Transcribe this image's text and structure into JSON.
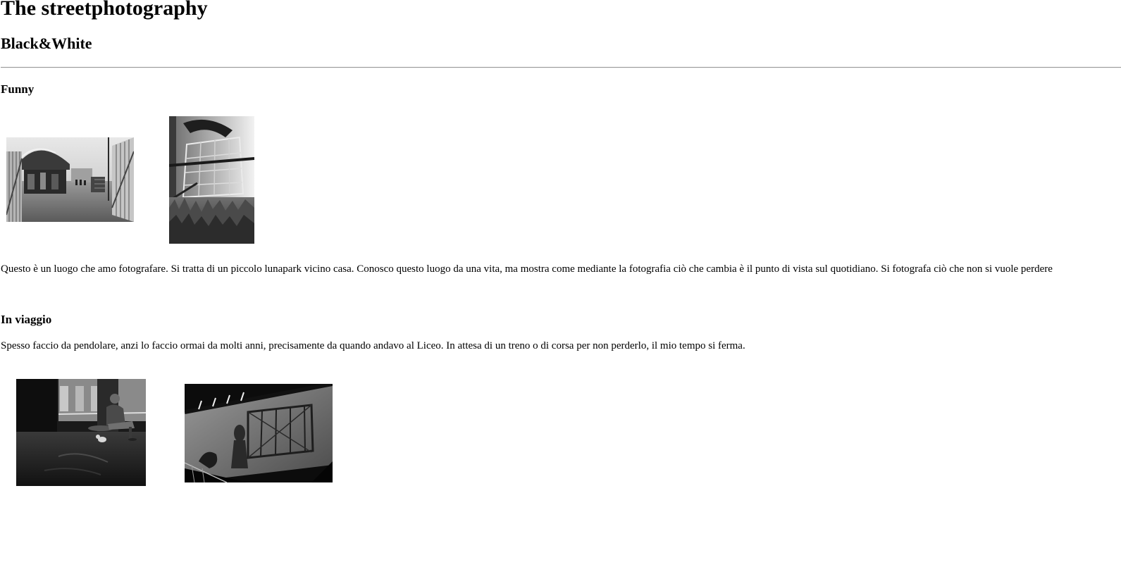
{
  "header": {
    "title": "The streetphotography",
    "subtitle": "Black&White"
  },
  "sections": {
    "funny": {
      "heading": "Funny",
      "text": "Questo è un luogo che amo fotografare. Si tratta di un piccolo lunapark vicino casa. Conosco questo luogo da una vita, ma mostra come mediante la fotografia ciò che cambia è il punto di vista sul quotidiano. Si fotografa ciò che non si vuole perdere"
    },
    "viaggio": {
      "heading": "In viaggio",
      "text": "Spesso faccio da pendolare, anzi lo faccio ormai da molti anni, precisamente da quando andavo al Liceo. In attesa di un treno o di corsa per non perderlo, il mio tempo si ferma."
    }
  },
  "colors": {
    "background": "#ffffff",
    "text": "#000000",
    "divider": "#9a9a9a"
  }
}
